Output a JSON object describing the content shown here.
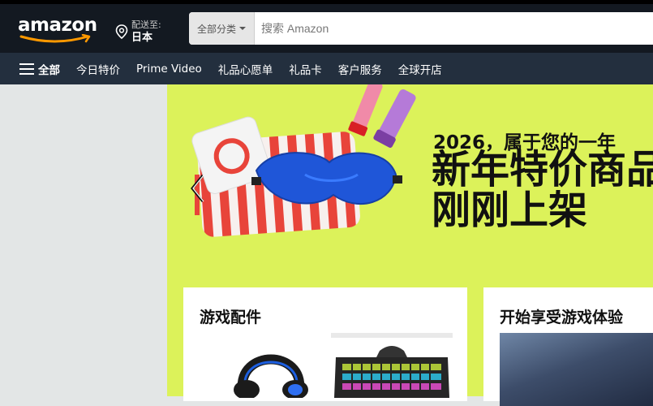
{
  "header": {
    "logo_text": "amazon",
    "deliver_label": "配送至:",
    "deliver_location": "日本",
    "search": {
      "category": "全部分类",
      "placeholder": "搜索 Amazon"
    }
  },
  "subnav": {
    "all_label": "全部",
    "items": [
      "今日特价",
      "Prime Video",
      "礼品心愿单",
      "礼品卡",
      "客户服务",
      "全球开店"
    ]
  },
  "hero": {
    "subtitle": "2026，属于您的一年",
    "title_line1": "新年特价商品",
    "title_line2": "刚刚上架"
  },
  "cards": [
    {
      "title": "游戏配件"
    },
    {
      "title": "开始享受游戏体验"
    }
  ],
  "colors": {
    "nav_dark": "#131921",
    "nav_sub": "#232f3e",
    "hero_bg": "#dcf25a",
    "logo_smile": "#ff9900"
  }
}
